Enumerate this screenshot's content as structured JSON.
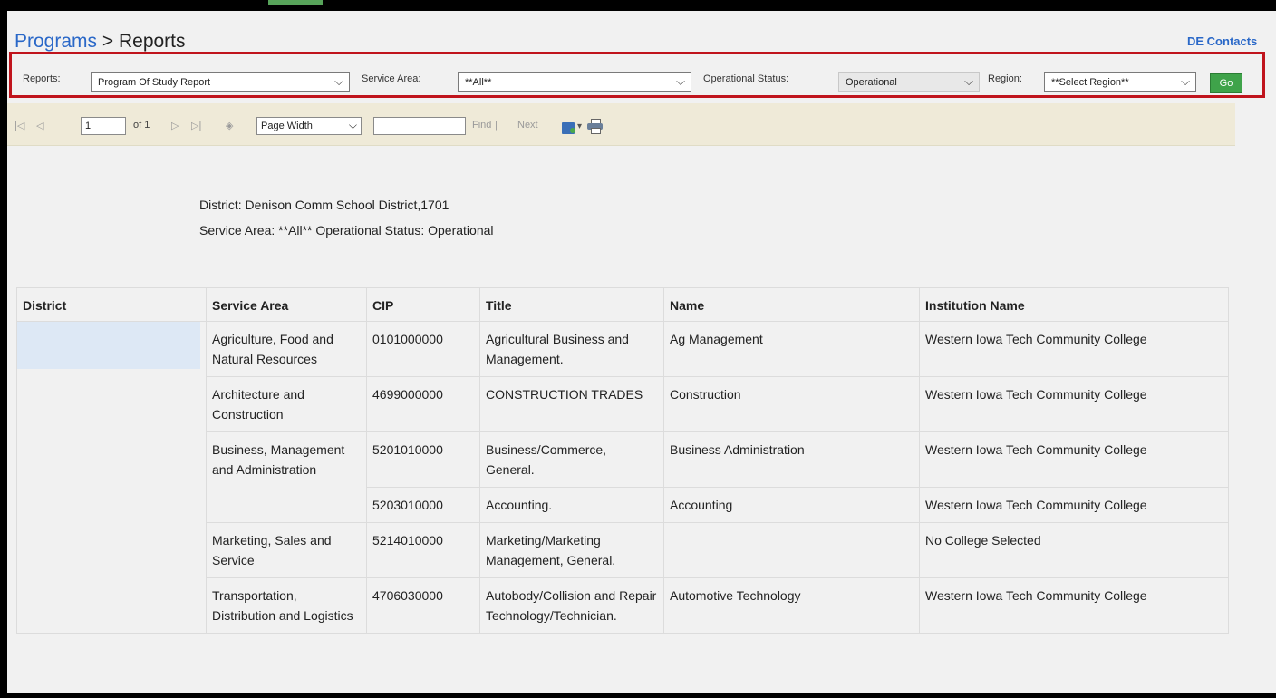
{
  "breadcrumb": {
    "programs": "Programs",
    "separator": " > ",
    "current": "Reports"
  },
  "header": {
    "de_contacts": "DE Contacts"
  },
  "filters": {
    "reports_label": "Reports:",
    "reports_value": "Program Of Study Report",
    "service_area_label": "Service Area:",
    "service_area_value": "**All**",
    "operational_status_label": "Operational Status:",
    "operational_status_value": "Operational",
    "region_label": "Region:",
    "region_value": "**Select Region**",
    "go_label": "Go"
  },
  "toolbar": {
    "first": "|◁",
    "prev": "◁",
    "page_value": "1",
    "of_pages": "of 1",
    "next": "▷",
    "last": "▷|",
    "refresh": "◈",
    "zoom_value": "Page Width",
    "find_value": "",
    "find_label": "Find",
    "separator": " | ",
    "next_label": "Next"
  },
  "report_info": {
    "district_line": "District: Denison Comm School District,1701",
    "status_line": "Service Area: **All** Operational Status: Operational"
  },
  "table": {
    "headers": [
      "District",
      "Service Area",
      "CIP",
      "Title",
      "Name",
      "Institution Name"
    ],
    "rows": [
      {
        "service_area": "Agriculture, Food and Natural Resources",
        "cip": "0101000000",
        "title": "Agricultural Business and Management.",
        "name": "Ag Management",
        "institution": "Western Iowa Tech Community College"
      },
      {
        "service_area": "Architecture and Construction",
        "cip": "4699000000",
        "title": "CONSTRUCTION TRADES",
        "name": "Construction",
        "institution": "Western Iowa Tech Community College"
      },
      {
        "service_area": "Business, Management and Administration",
        "cip": "5201010000",
        "title": "Business/Commerce, General.",
        "name": "Business Administration",
        "institution": "Western Iowa Tech Community College"
      },
      {
        "service_area": "",
        "cip": "5203010000",
        "title": "Accounting.",
        "name": "Accounting",
        "institution": "Western Iowa Tech Community College"
      },
      {
        "service_area": "Marketing, Sales and Service",
        "cip": "5214010000",
        "title": "Marketing/Marketing Management, General.",
        "name": "",
        "institution": "No College Selected"
      },
      {
        "service_area": "Transportation, Distribution and Logistics",
        "cip": "4706030000",
        "title": "Autobody/Collision and Repair Technology/Technician.",
        "name": "Automotive Technology",
        "institution": "Western Iowa Tech Community College"
      }
    ]
  },
  "colors": {
    "accent_link": "#2a68c8",
    "filter_border": "#c0141c",
    "go_button": "#3fa34a",
    "toolbar_bg": "#efead8"
  }
}
